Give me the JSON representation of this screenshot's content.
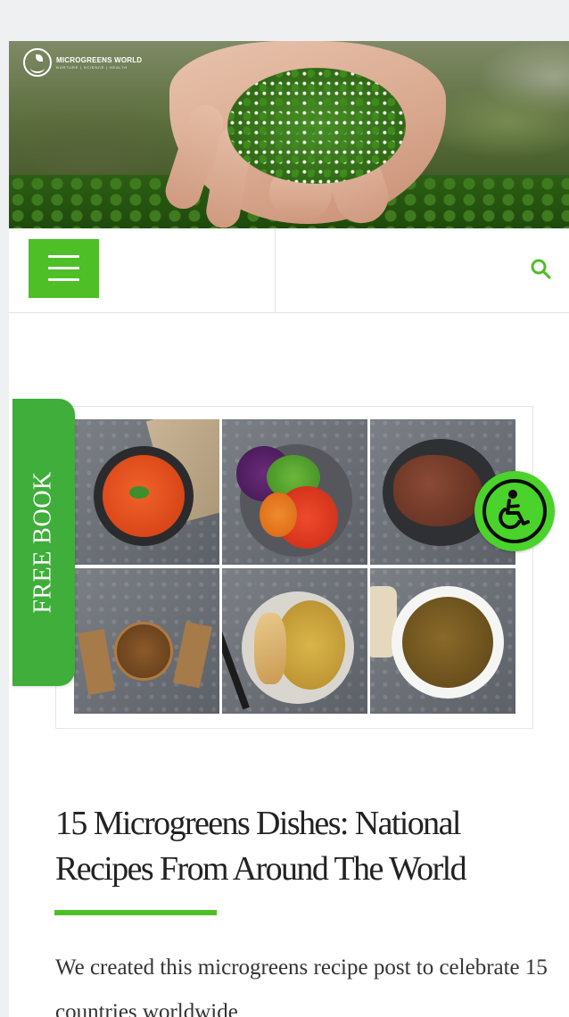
{
  "brand": {
    "name": "MICROGREENS WORLD",
    "tagline": "NURTURE | SCIENCE | HEALTH",
    "accent_color": "#4ebf26",
    "logo_icon": "sprout-bowl-logo-icon"
  },
  "nav": {
    "menu_icon": "hamburger-menu-icon",
    "search_icon": "search-icon"
  },
  "side_tab": {
    "label": "FREE BOOK",
    "color": "#3fae3a"
  },
  "accessibility": {
    "icon": "wheelchair-icon",
    "color": "#4ad32a"
  },
  "article": {
    "title": "15 Microgreens Dishes: National Recipes From Around The World",
    "excerpt": "We created this microgreens recipe post to celebrate 15 countries worldwide"
  }
}
